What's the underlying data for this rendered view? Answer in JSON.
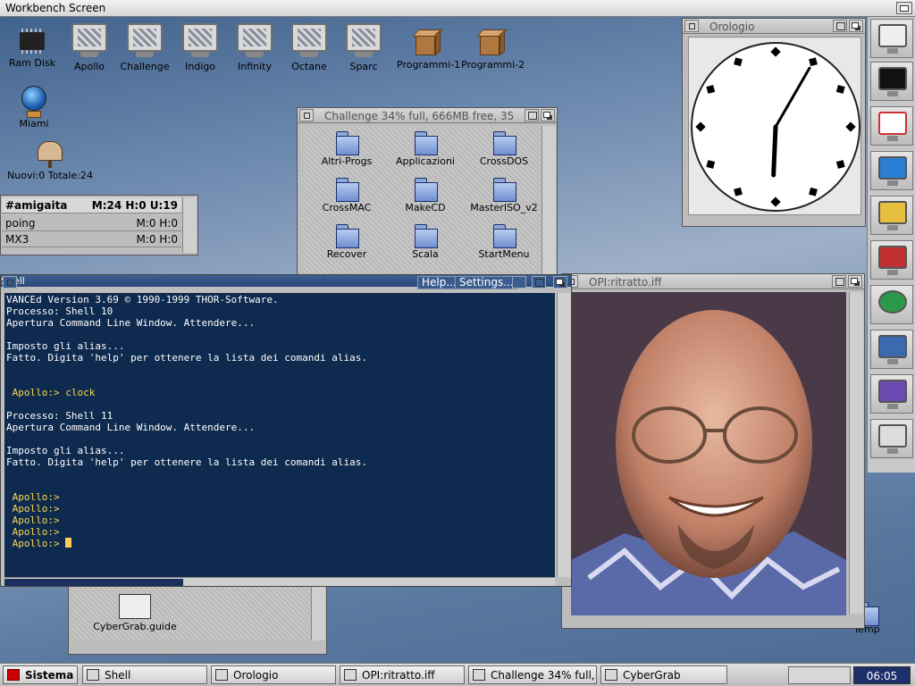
{
  "screen": {
    "title": "Workbench Screen"
  },
  "desktop_icons": [
    {
      "label": "Ram Disk",
      "icon": "chip-icon"
    },
    {
      "label": "Apollo",
      "icon": "monitor-icon"
    },
    {
      "label": "Challenge",
      "icon": "monitor-icon"
    },
    {
      "label": "Indigo",
      "icon": "monitor-icon"
    },
    {
      "label": "Infinity",
      "icon": "monitor-icon"
    },
    {
      "label": "Octane",
      "icon": "monitor-icon"
    },
    {
      "label": "Sparc",
      "icon": "monitor-icon"
    },
    {
      "label": "Programmi-1",
      "icon": "box-icon"
    },
    {
      "label": "Programmi-2",
      "icon": "box-icon"
    },
    {
      "label": "Miami",
      "icon": "globe-icon"
    },
    {
      "label": "Nuovi:0 Totale:24",
      "icon": "mailbox-icon"
    },
    {
      "label": "Temp",
      "icon": "folder-icon"
    }
  ],
  "amigaita": {
    "rows": [
      {
        "name": "#amigaita",
        "stats": "M:24 H:0 U:19"
      },
      {
        "name": "poing",
        "stats": "M:0 H:0"
      },
      {
        "name": "MX3",
        "stats": "M:0 H:0"
      }
    ]
  },
  "challenge_window": {
    "title": "Challenge  34% full, 666MB free, 35",
    "folders": [
      "Altri-Progs",
      "Applicazioni",
      "CrossDOS",
      "CrossMAC",
      "MakeCD",
      "MasterISO_v2",
      "Recover",
      "Scala",
      "StartMenu"
    ]
  },
  "clock_window": {
    "title": "Orologio",
    "hour": 6,
    "minute": 5
  },
  "opi_window": {
    "title": "OPI:ritratto.iff"
  },
  "cybergrab_window": {
    "file": "CyberGrab.guide"
  },
  "shell": {
    "title": "Shell",
    "help_label": "Help...",
    "settings_label": "Settings...",
    "lines": [
      {
        "text": "VANCEd Version 3.69 © 1990-1999 THOR-Software.",
        "prompt": false
      },
      {
        "text": "Processo: Shell 10",
        "prompt": false
      },
      {
        "text": "Apertura Command Line Window. Attendere...",
        "prompt": false
      },
      {
        "text": "",
        "prompt": false
      },
      {
        "text": "Imposto gli alias...",
        "prompt": false
      },
      {
        "text": "Fatto. Digita 'help' per ottenere la lista dei comandi alias.",
        "prompt": false
      },
      {
        "text": "",
        "prompt": false
      },
      {
        "text": "",
        "prompt": false
      },
      {
        "text": " Apollo:> clock",
        "prompt": true
      },
      {
        "text": "",
        "prompt": false
      },
      {
        "text": "Processo: Shell 11",
        "prompt": false
      },
      {
        "text": "Apertura Command Line Window. Attendere...",
        "prompt": false
      },
      {
        "text": "",
        "prompt": false
      },
      {
        "text": "Imposto gli alias...",
        "prompt": false
      },
      {
        "text": "Fatto. Digita 'help' per ottenere la lista dei comandi alias.",
        "prompt": false
      },
      {
        "text": "",
        "prompt": false
      },
      {
        "text": "",
        "prompt": false
      },
      {
        "text": " Apollo:>",
        "prompt": true
      },
      {
        "text": " Apollo:>",
        "prompt": true
      },
      {
        "text": " Apollo:>",
        "prompt": true
      },
      {
        "text": " Apollo:>",
        "prompt": true
      },
      {
        "text": " Apollo:> ",
        "prompt": true
      }
    ]
  },
  "taskbar": {
    "start_label": "Sistema",
    "tasks": [
      "Shell",
      "Orologio",
      "OPI:ritratto.iff",
      "Challenge  34% full,",
      "CyberGrab"
    ],
    "time": "06:05"
  },
  "colors": {
    "shell_bg": "#0e2a4e",
    "prompt": "#ffd84a",
    "title_active": "#2a4778"
  }
}
